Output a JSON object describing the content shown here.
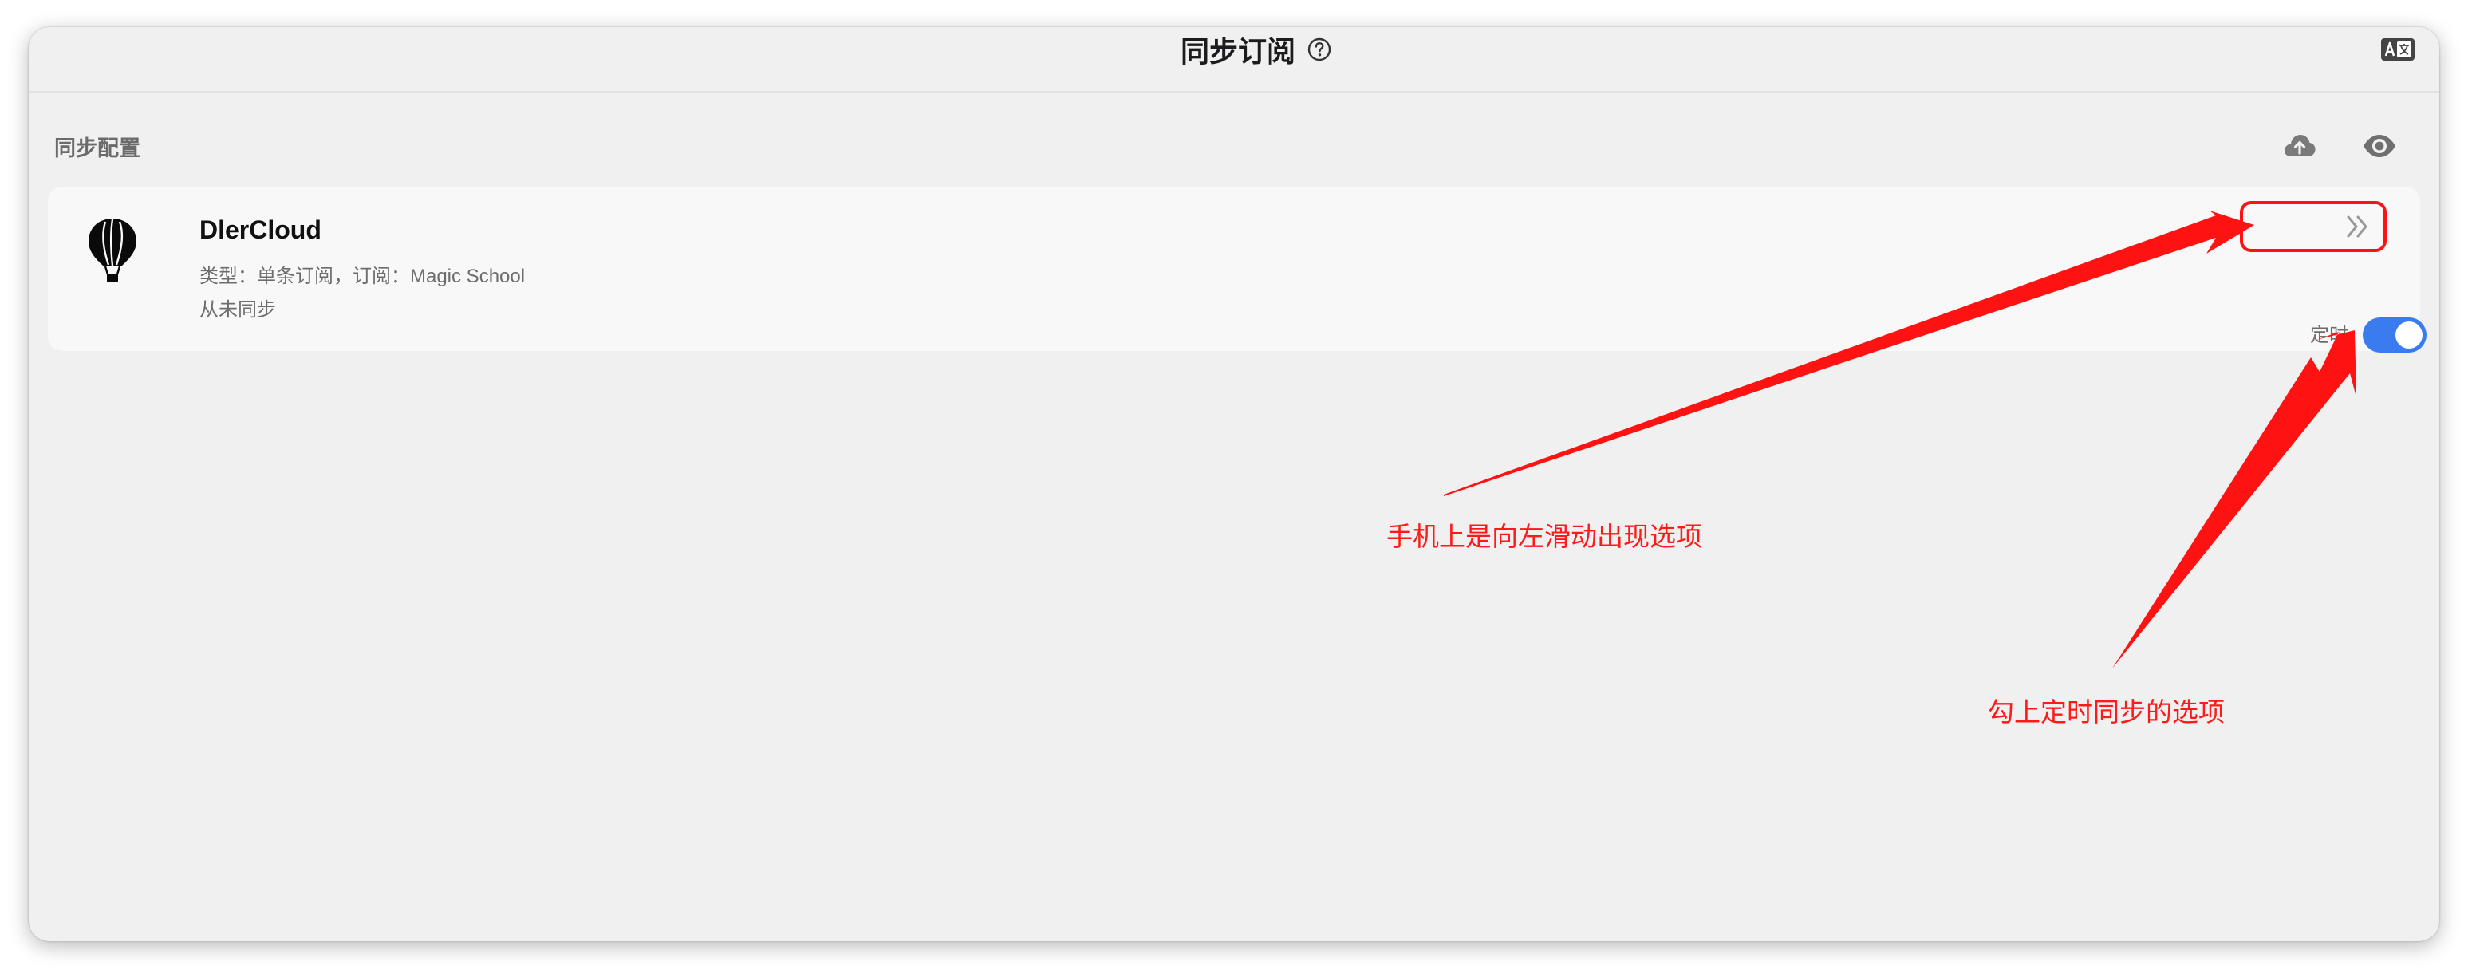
{
  "window": {
    "title": "同步订阅"
  },
  "section": {
    "label": "同步配置"
  },
  "card": {
    "name": "DlerCloud",
    "meta": "类型：单条订阅，订阅：Magic School",
    "status": "从未同步",
    "timer_label": "定时",
    "timer_enabled": true
  },
  "annotations": {
    "swipe_note": "手机上是向左滑动出现选项",
    "timer_note": "勾上定时同步的选项"
  },
  "icons": {
    "help": "help-circle-icon",
    "translate": "translate-icon",
    "upload": "cloud-upload-icon",
    "preview": "eye-icon",
    "provider": "hot-air-balloon-icon",
    "more": "double-chevron-right-icon"
  },
  "colors": {
    "accent": "#3a7bf0",
    "annotation": "#ff1a1a",
    "background": "#f0f0f0",
    "card": "#f8f8f8"
  }
}
